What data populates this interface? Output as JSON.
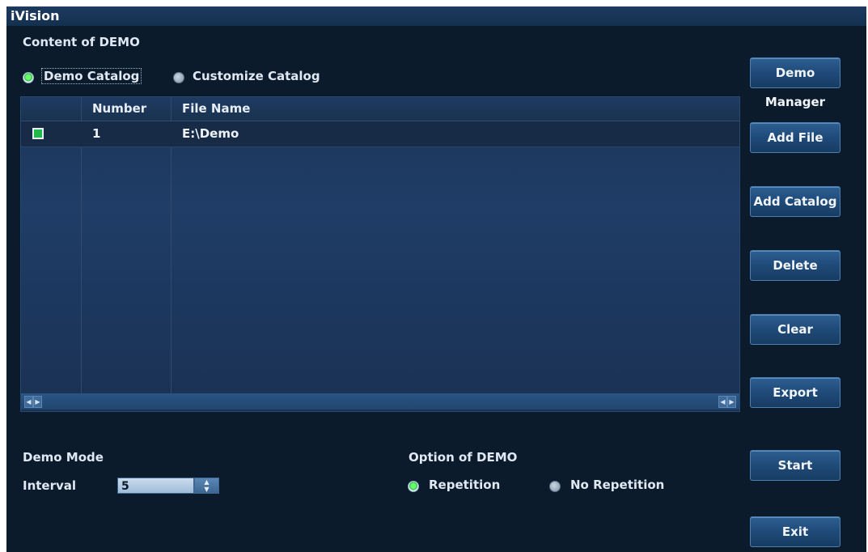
{
  "window": {
    "title": "iVision"
  },
  "content": {
    "section_label": "Content of DEMO",
    "radio_demo_catalog": "Demo Catalog",
    "radio_customize_catalog": "Customize Catalog",
    "selected": "Demo Catalog"
  },
  "table": {
    "headers": [
      "",
      "Number",
      "File Name"
    ],
    "rows": [
      {
        "checked": true,
        "number": "1",
        "file_name": "E:\\Demo"
      }
    ]
  },
  "buttons": {
    "demo_manager": "Demo Manager",
    "add_file": "Add File",
    "add_catalog": "Add Catalog",
    "delete": "Delete",
    "clear": "Clear",
    "export": "Export",
    "start": "Start",
    "exit": "Exit"
  },
  "demo_mode": {
    "label": "Demo Mode",
    "interval_label": "Interval",
    "interval_value": "5"
  },
  "option": {
    "label": "Option of DEMO",
    "repetition": "Repetition",
    "no_repetition": "No Repetition",
    "selected": "Repetition"
  },
  "colors": {
    "background": "#0b1b2c",
    "button": "#1f4a78",
    "radio_on": "#2fb84a"
  }
}
